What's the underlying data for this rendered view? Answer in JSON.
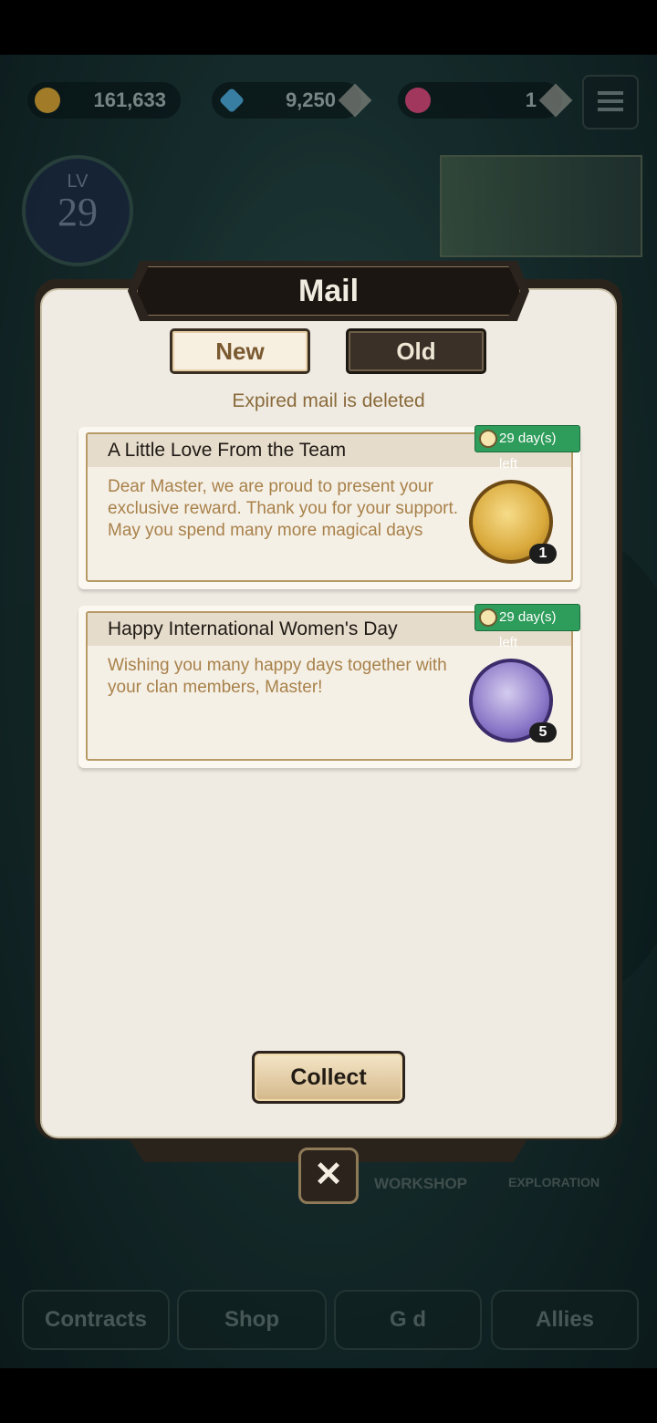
{
  "resources": [
    {
      "icon": "gold-coin-icon",
      "value": "161,633"
    },
    {
      "icon": "blue-gem-icon",
      "value": "9,250"
    },
    {
      "icon": "pink-gem-icon",
      "value": "1"
    }
  ],
  "level": {
    "label": "LV",
    "value": "29"
  },
  "background_tags": {
    "workshop": "WORKSHOP",
    "exploration": "EXPLORATION"
  },
  "bottom_nav": [
    "Contracts",
    "Shop",
    "G  d",
    "Allies"
  ],
  "mail": {
    "title": "Mail",
    "tabs": {
      "new": "New",
      "old": "Old"
    },
    "notice": "Expired mail is deleted",
    "items": [
      {
        "title": "A Little Love From the Team",
        "body": "Dear Master, we are proud to present your exclusive reward. Thank you for your support. May you spend many more magical days",
        "days_left": "29 day(s) left",
        "reward_icon": "scroll-reward-icon",
        "count": "1"
      },
      {
        "title": "Happy International Women's Day",
        "body": "Wishing you many happy days together with your clan members, Master!",
        "days_left": "29 day(s) left",
        "reward_icon": "potion-reward-icon",
        "count": "5"
      }
    ],
    "collect_label": "Collect",
    "close_label": "✕"
  }
}
